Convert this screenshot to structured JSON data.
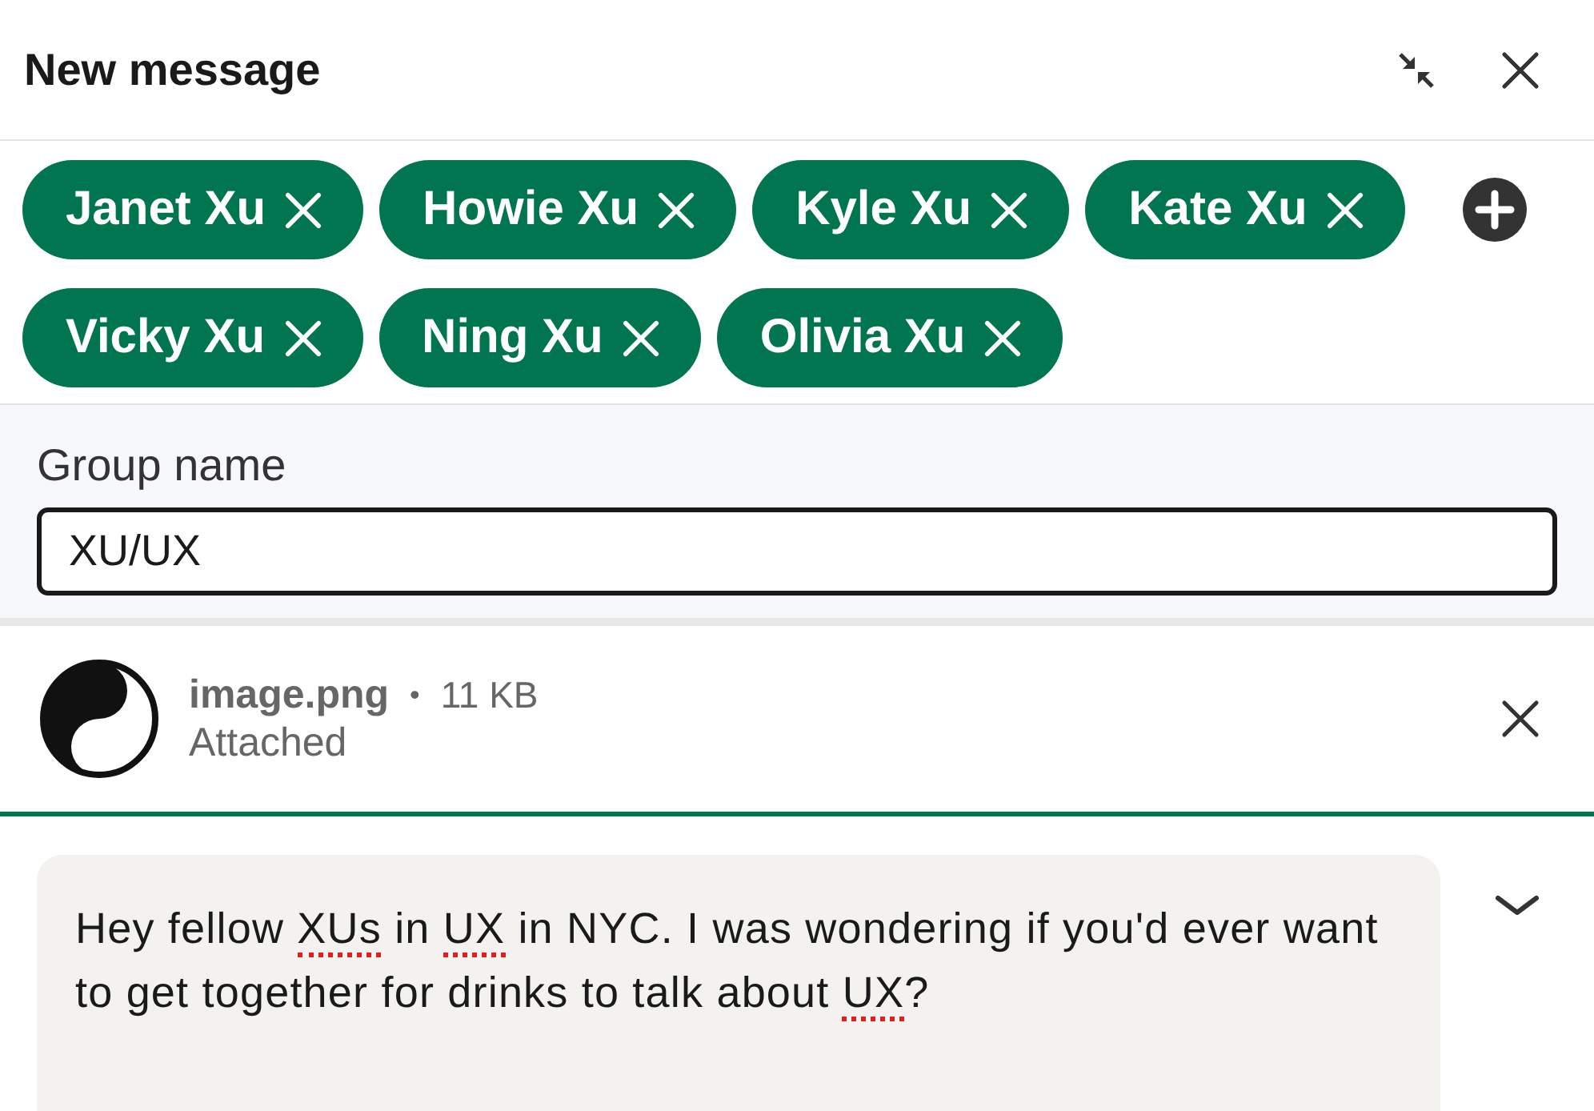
{
  "header": {
    "title": "New message"
  },
  "recipients": [
    {
      "name": "Janet Xu"
    },
    {
      "name": "Howie Xu"
    },
    {
      "name": "Kyle Xu"
    },
    {
      "name": "Kate Xu"
    },
    {
      "name": "Vicky Xu"
    },
    {
      "name": "Ning Xu"
    },
    {
      "name": "Olivia Xu"
    }
  ],
  "group_name": {
    "label": "Group name",
    "value": "XU/UX"
  },
  "attachment": {
    "filename": "image.png",
    "separator": "•",
    "size": "11 KB",
    "status": "Attached"
  },
  "message": {
    "segments": [
      {
        "text": "Hey fellow ",
        "flagged": false
      },
      {
        "text": "XUs",
        "flagged": true
      },
      {
        "text": " in ",
        "flagged": false
      },
      {
        "text": "UX",
        "flagged": true
      },
      {
        "text": " in NYC. I was wondering if you'd ever want to get together for drinks to talk about ",
        "flagged": false
      },
      {
        "text": "UX",
        "flagged": true
      },
      {
        "text": "?",
        "flagged": false
      }
    ]
  }
}
